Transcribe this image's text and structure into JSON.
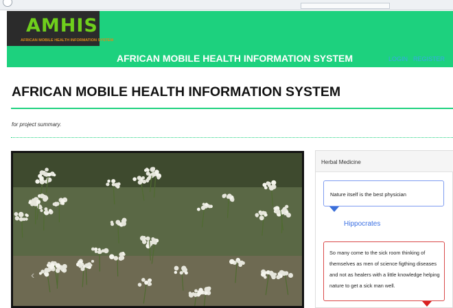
{
  "header": {
    "logo_text": "AMHIS",
    "logo_tagline": "AFRICAN MOBILE HEALTH INFORMATION SYSTEM",
    "title": "AFRICAN MOBILE HEALTH INFORMATION SYSTEM",
    "nav": {
      "login": "LOGIN",
      "register": "REGISTER"
    }
  },
  "main": {
    "page_title": "AFRICAN MOBILE HEALTH INFORMATION SYSTEM",
    "summary": "for project summary."
  },
  "carousel": {
    "prev_icon": "‹",
    "next_icon": "›"
  },
  "sidebar": {
    "title": "Herbal Medicine",
    "quotes": [
      {
        "text": "Nature itself is the best physician",
        "author": "Hippocrates"
      },
      {
        "text": "So many come to the sick room thinking of themselves as men of science figthing diseases and not as healers with a little knowledge helping nature to get a sick man well."
      }
    ]
  },
  "colors": {
    "brand_green": "#1dd17e",
    "logo_green": "#6fcf1c",
    "link_blue": "#38a8e8",
    "quote_blue": "#3a6fe3",
    "quote_red": "#d94848"
  }
}
